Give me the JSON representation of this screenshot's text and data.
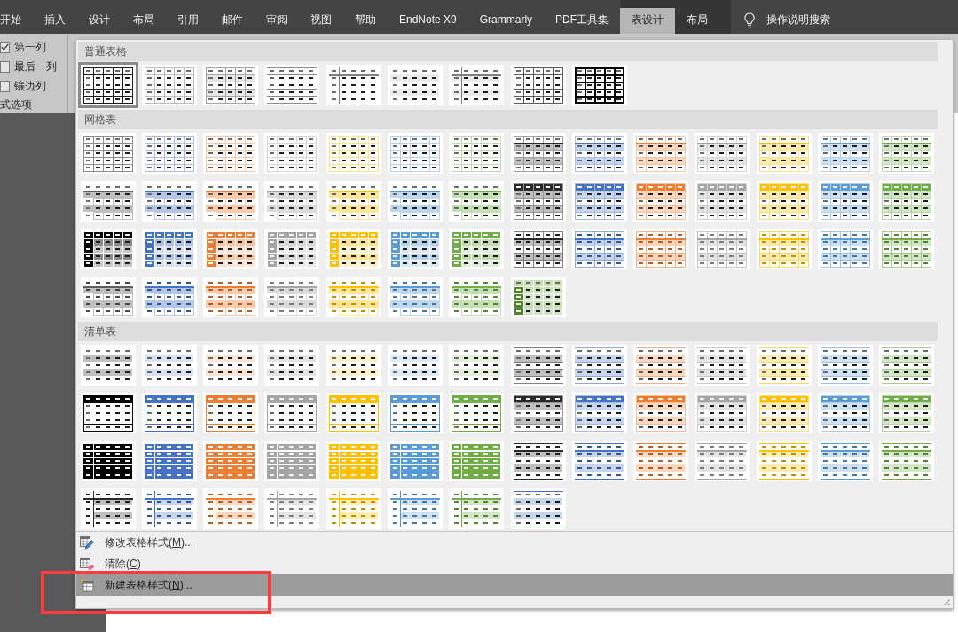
{
  "ribbon_tabs": [
    {
      "label": "开始",
      "kind": "standard",
      "selected": false
    },
    {
      "label": "插入",
      "kind": "standard",
      "selected": false
    },
    {
      "label": "设计",
      "kind": "standard",
      "selected": false
    },
    {
      "label": "布局",
      "kind": "standard",
      "selected": false
    },
    {
      "label": "引用",
      "kind": "standard",
      "selected": false
    },
    {
      "label": "邮件",
      "kind": "standard",
      "selected": false
    },
    {
      "label": "审阅",
      "kind": "standard",
      "selected": false
    },
    {
      "label": "视图",
      "kind": "standard",
      "selected": false
    },
    {
      "label": "帮助",
      "kind": "standard",
      "selected": false
    },
    {
      "label": "EndNote X9",
      "kind": "standard",
      "selected": false
    },
    {
      "label": "Grammarly",
      "kind": "standard",
      "selected": false
    },
    {
      "label": "PDF工具集",
      "kind": "standard",
      "selected": false
    },
    {
      "label": "表设计",
      "kind": "contextual",
      "selected": true
    },
    {
      "label": "布局",
      "kind": "contextual",
      "selected": false
    }
  ],
  "tell_me": {
    "label": "操作说明搜索"
  },
  "style_options": {
    "items": [
      {
        "label": "第一列",
        "checked": true
      },
      {
        "label": "最后一列",
        "checked": false
      },
      {
        "label": "镶边列",
        "checked": false
      }
    ],
    "group_label": "式选项"
  },
  "gallery": {
    "sections": [
      {
        "title": "普通表格",
        "styles": [
          {
            "kind": "table-grid",
            "selected": true
          },
          {
            "kind": "grid-light",
            "selected": false
          },
          {
            "kind": "plain1",
            "selected": false
          },
          {
            "kind": "plain2",
            "selected": false
          },
          {
            "kind": "plain3",
            "selected": false
          },
          {
            "kind": "plain4",
            "selected": false
          },
          {
            "kind": "plain5",
            "selected": false
          },
          {
            "kind": "grid-dark",
            "selected": false
          },
          {
            "kind": "grid-bold",
            "selected": false
          }
        ]
      },
      {
        "title": "网格表",
        "styles": [
          {
            "kind": "grid1",
            "color": "#8c8c8c",
            "selected": false
          },
          {
            "kind": "grid1",
            "color": "#abc0e4",
            "selected": false
          },
          {
            "kind": "grid1",
            "color": "#f7c5a2",
            "selected": false
          },
          {
            "kind": "grid1",
            "color": "#d7d7d7",
            "selected": false
          },
          {
            "kind": "grid1",
            "color": "#ffe38c",
            "selected": false
          },
          {
            "kind": "grid1",
            "color": "#b5d2ec",
            "selected": false
          },
          {
            "kind": "grid1",
            "color": "#bfdaac",
            "selected": false
          },
          {
            "kind": "grid2",
            "color": "#bfbfbf",
            "selected": false
          },
          {
            "kind": "grid2",
            "color": "#c7d5ed",
            "selected": false
          },
          {
            "kind": "grid2",
            "color": "#fad8c1",
            "selected": false
          },
          {
            "kind": "grid2",
            "color": "#e4e4e4",
            "selected": false
          },
          {
            "kind": "grid2",
            "color": "#ffecb3",
            "selected": false
          },
          {
            "kind": "grid2",
            "color": "#cee1f2",
            "selected": false
          },
          {
            "kind": "grid2",
            "color": "#d4e6c8",
            "selected": false
          },
          {
            "kind": "grid3",
            "color": "#bfbfbf",
            "selected": false
          },
          {
            "kind": "grid3",
            "color": "#b4c7e7",
            "selected": false
          },
          {
            "kind": "grid3",
            "color": "#f8cbad",
            "selected": false
          },
          {
            "kind": "grid3",
            "color": "#dbdbdb",
            "selected": false
          },
          {
            "kind": "grid3",
            "color": "#ffe699",
            "selected": false
          },
          {
            "kind": "grid3",
            "color": "#bdd7ee",
            "selected": false
          },
          {
            "kind": "grid3",
            "color": "#c6e0b5",
            "selected": false
          },
          {
            "kind": "grid4",
            "color": "#bfbfbf",
            "selected": false
          },
          {
            "kind": "grid4",
            "color": "#c7d5ed",
            "selected": false
          },
          {
            "kind": "grid4",
            "color": "#fad8c1",
            "selected": false
          },
          {
            "kind": "grid4",
            "color": "#e4e4e4",
            "selected": false
          },
          {
            "kind": "grid4",
            "color": "#ffecb3",
            "selected": false
          },
          {
            "kind": "grid4",
            "color": "#cee1f2",
            "selected": false
          },
          {
            "kind": "grid4",
            "color": "#d4e6c8",
            "selected": false
          },
          {
            "kind": "grid5",
            "color": "#000000",
            "selected": false
          },
          {
            "kind": "grid5",
            "color": "#4472c4",
            "selected": false
          },
          {
            "kind": "grid5",
            "color": "#ed7d31",
            "selected": false
          },
          {
            "kind": "grid5",
            "color": "#a5a5a5",
            "selected": false
          },
          {
            "kind": "grid5",
            "color": "#ffc000",
            "selected": false
          },
          {
            "kind": "grid5",
            "color": "#5b9bd5",
            "selected": false
          },
          {
            "kind": "grid5",
            "color": "#70ad47",
            "selected": false
          },
          {
            "kind": "grid6",
            "color": "#bfbfbf",
            "selected": false
          },
          {
            "kind": "grid6",
            "color": "#c7d5ed",
            "selected": false
          },
          {
            "kind": "grid6",
            "color": "#fad8c1",
            "selected": false
          },
          {
            "kind": "grid6",
            "color": "#e4e4e4",
            "selected": false
          },
          {
            "kind": "grid6",
            "color": "#ffecb3",
            "selected": false
          },
          {
            "kind": "grid6",
            "color": "#cee1f2",
            "selected": false
          },
          {
            "kind": "grid6",
            "color": "#d4e6c8",
            "selected": false
          },
          {
            "kind": "grid7",
            "color": "#bfbfbf",
            "selected": false
          },
          {
            "kind": "grid7",
            "color": "#b4c7e7",
            "selected": false
          },
          {
            "kind": "grid7",
            "color": "#f8cbad",
            "selected": false
          },
          {
            "kind": "grid7",
            "color": "#dbdbdb",
            "selected": false
          },
          {
            "kind": "grid7",
            "color": "#ffe699",
            "selected": false
          },
          {
            "kind": "grid7",
            "color": "#bdd7ee",
            "selected": false
          },
          {
            "kind": "grid7",
            "color": "#c6e0b5",
            "selected": false
          },
          {
            "kind": "accent-column",
            "color": "#c5e0b3",
            "selected": false
          }
        ]
      },
      {
        "title": "清单表",
        "styles": [
          {
            "kind": "list1",
            "color": "#bfbfbf",
            "selected": false
          },
          {
            "kind": "list1",
            "color": "#d9e2f3",
            "selected": false
          },
          {
            "kind": "list1",
            "color": "#fbe4d5",
            "selected": false
          },
          {
            "kind": "list1",
            "color": "#e4e4e4",
            "selected": false
          },
          {
            "kind": "list1",
            "color": "#fff2cc",
            "selected": false
          },
          {
            "kind": "list1",
            "color": "#deebf6",
            "selected": false
          },
          {
            "kind": "list1",
            "color": "#e2efd9",
            "selected": false
          },
          {
            "kind": "list2",
            "color": "#bfbfbf",
            "selected": false
          },
          {
            "kind": "list2",
            "color": "#c7d5ed",
            "selected": false
          },
          {
            "kind": "list2",
            "color": "#fad8c1",
            "selected": false
          },
          {
            "kind": "list2",
            "color": "#e4e4e4",
            "selected": false
          },
          {
            "kind": "list2",
            "color": "#ffecb3",
            "selected": false
          },
          {
            "kind": "list2",
            "color": "#cee1f2",
            "selected": false
          },
          {
            "kind": "list2",
            "color": "#d4e6c8",
            "selected": false
          },
          {
            "kind": "list3",
            "color": "#000000",
            "selected": false
          },
          {
            "kind": "list3",
            "color": "#4472c4",
            "selected": false
          },
          {
            "kind": "list3",
            "color": "#ed7d31",
            "selected": false
          },
          {
            "kind": "list3",
            "color": "#a5a5a5",
            "selected": false
          },
          {
            "kind": "list3",
            "color": "#ffc000",
            "selected": false
          },
          {
            "kind": "list3",
            "color": "#5b9bd5",
            "selected": false
          },
          {
            "kind": "list3",
            "color": "#70ad47",
            "selected": false
          },
          {
            "kind": "list4",
            "color": "#bfbfbf",
            "selected": false
          },
          {
            "kind": "list4",
            "color": "#c7d5ed",
            "selected": false
          },
          {
            "kind": "list4",
            "color": "#fad8c1",
            "selected": false
          },
          {
            "kind": "list4",
            "color": "#e4e4e4",
            "selected": false
          },
          {
            "kind": "list4",
            "color": "#ffecb3",
            "selected": false
          },
          {
            "kind": "list4",
            "color": "#cee1f2",
            "selected": false
          },
          {
            "kind": "list4",
            "color": "#d4e6c8",
            "selected": false
          },
          {
            "kind": "list5",
            "color": "#000000",
            "selected": false
          },
          {
            "kind": "list5",
            "color": "#4472c4",
            "selected": false
          },
          {
            "kind": "list5",
            "color": "#ed7d31",
            "selected": false
          },
          {
            "kind": "list5",
            "color": "#a5a5a5",
            "selected": false
          },
          {
            "kind": "list5",
            "color": "#ffc000",
            "selected": false
          },
          {
            "kind": "list5",
            "color": "#5b9bd5",
            "selected": false
          },
          {
            "kind": "list5",
            "color": "#70ad47",
            "selected": false
          },
          {
            "kind": "list6",
            "color": "#bfbfbf",
            "selected": false
          },
          {
            "kind": "list6",
            "color": "#c7d5ed",
            "selected": false
          },
          {
            "kind": "list6",
            "color": "#fad8c1",
            "selected": false
          },
          {
            "kind": "list6",
            "color": "#e4e4e4",
            "selected": false
          },
          {
            "kind": "list6",
            "color": "#ffecb3",
            "selected": false
          },
          {
            "kind": "list6",
            "color": "#cee1f2",
            "selected": false
          },
          {
            "kind": "list6",
            "color": "#d4e6c8",
            "selected": false
          },
          {
            "kind": "list7",
            "color": "#bfbfbf",
            "selected": false
          },
          {
            "kind": "list7",
            "color": "#c7d5ed",
            "selected": false
          },
          {
            "kind": "list7",
            "color": "#fad8c1",
            "selected": false
          },
          {
            "kind": "list7",
            "color": "#e4e4e4",
            "selected": false
          },
          {
            "kind": "list7",
            "color": "#ffecb3",
            "selected": false
          },
          {
            "kind": "list7",
            "color": "#cee1f2",
            "selected": false
          },
          {
            "kind": "list7",
            "color": "#d4e6c8",
            "selected": false
          },
          {
            "kind": "band-rules",
            "color": "#c7d5ed",
            "selected": false
          }
        ]
      }
    ],
    "commands": [
      {
        "kind": "modify",
        "label": "修改表格样式(",
        "key": "M",
        "suffix": ")...",
        "hovered": false,
        "highlighted": false
      },
      {
        "kind": "clear",
        "label": "清除(",
        "key": "C",
        "suffix": ")",
        "hovered": false,
        "highlighted": false
      },
      {
        "kind": "new",
        "label": "新建表格样式(",
        "key": "N",
        "suffix": ")...",
        "hovered": true,
        "highlighted": true
      }
    ]
  }
}
